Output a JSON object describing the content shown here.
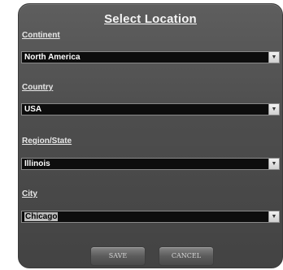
{
  "dialog": {
    "title": "Select Location"
  },
  "fields": {
    "continent": {
      "label": "Continent",
      "value": "North America"
    },
    "country": {
      "label": "Country",
      "value": "USA"
    },
    "region": {
      "label": "Region/State",
      "value": "Illinois"
    },
    "city": {
      "label": "City",
      "value": "Chicago"
    }
  },
  "buttons": {
    "save": "SAVE",
    "cancel": "CANCEL"
  },
  "icons": {
    "dropdown": "chevron-down-icon"
  },
  "colors": {
    "dialog_bg": "#4d4d4d",
    "select_bg": "#0d0d0d",
    "text": "#ffffff"
  }
}
